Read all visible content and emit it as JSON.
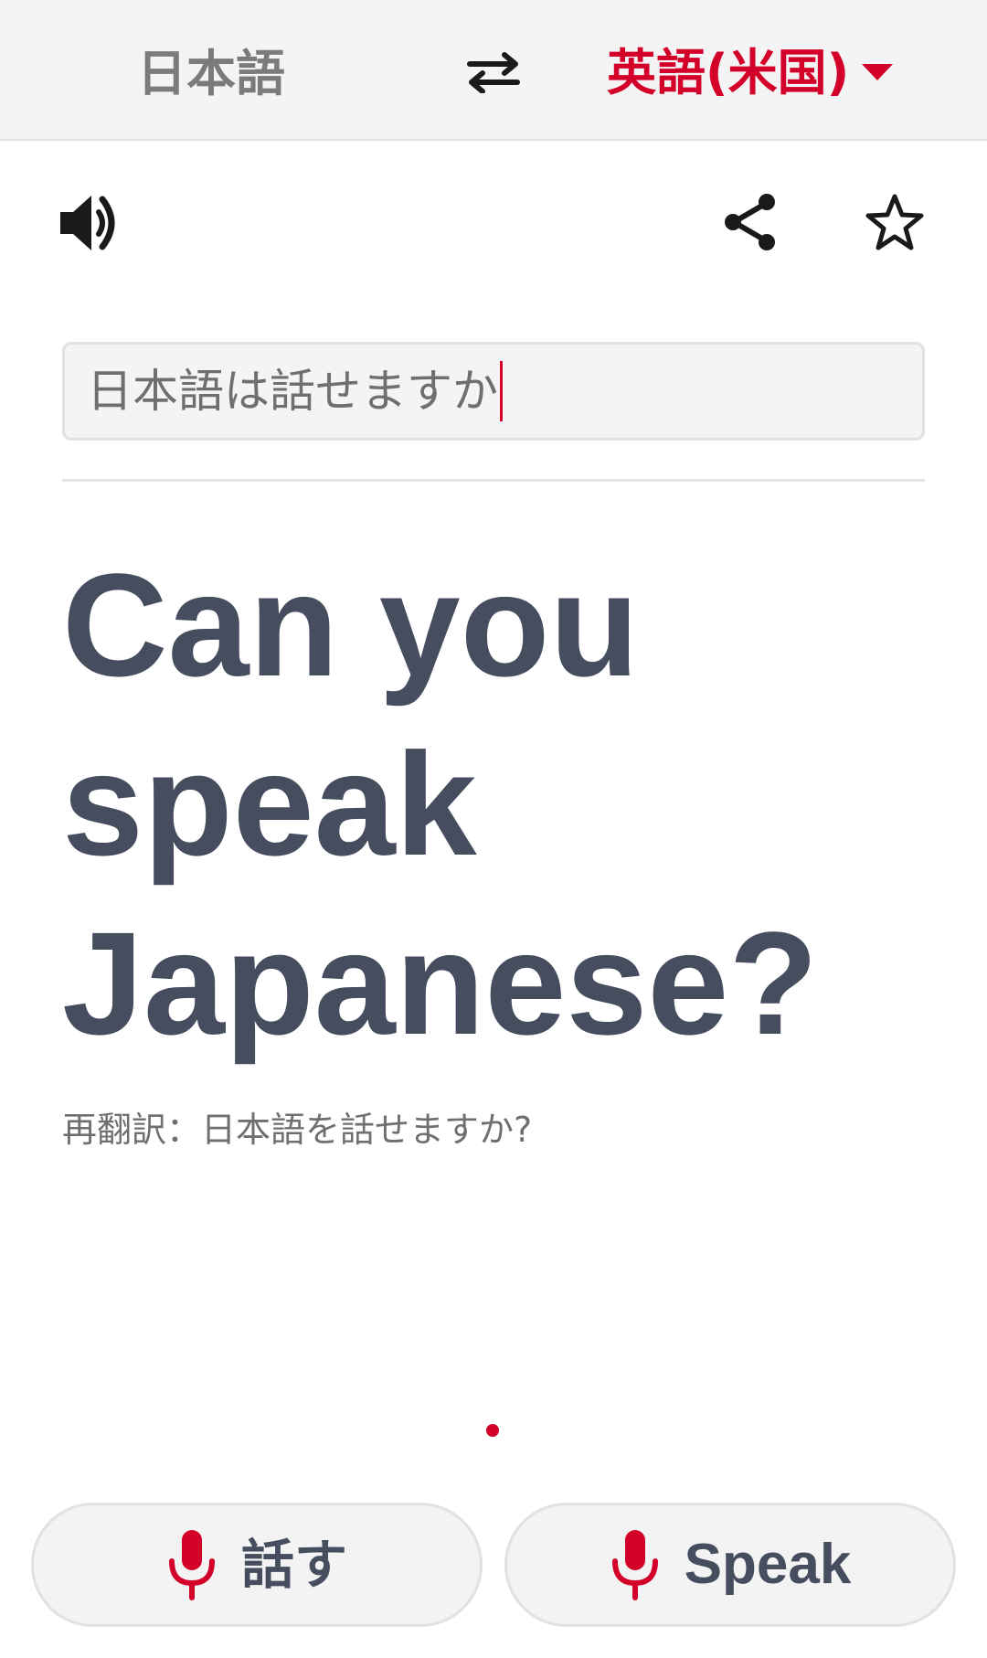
{
  "header": {
    "source_language": "日本語",
    "target_language": "英語(米国)",
    "swap_icon": "swap-arrows-icon",
    "dropdown_icon": "caret-down-icon"
  },
  "toolbar": {
    "speaker_icon": "speaker-icon",
    "share_icon": "share-icon",
    "favorite_icon": "star-outline-icon"
  },
  "input": {
    "value": "日本語は話せますか"
  },
  "result": {
    "translation_lines": [
      "Can you",
      "speak",
      "Japanese?"
    ],
    "back_translation": "再翻訳：日本語を話せますか?"
  },
  "speak_buttons": [
    {
      "label": "話す",
      "icon": "microphone-icon"
    },
    {
      "label": "Speak",
      "icon": "microphone-icon"
    }
  ],
  "colors": {
    "accent": "#d3002a",
    "text_dark": "#454d5e",
    "text_muted": "#6f6f6f",
    "header_bg": "#f4f4f4"
  }
}
